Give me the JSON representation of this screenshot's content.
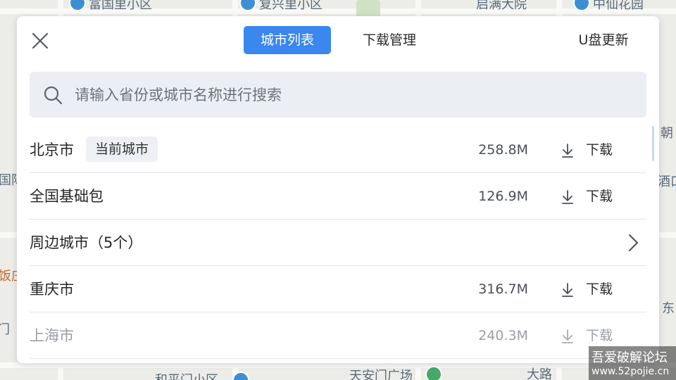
{
  "map": {
    "labels": [
      "富国里小区",
      "复兴里小区",
      "启满大院",
      "中仙花园",
      "朝",
      "国际",
      "酒口",
      "饭庄",
      "门",
      "东",
      "和平门小区",
      "天安门广场",
      "大路"
    ]
  },
  "dialog": {
    "tabs": [
      {
        "label": "城市列表",
        "active": true
      },
      {
        "label": "下载管理",
        "active": false
      },
      {
        "label": "U盘更新",
        "active": false
      }
    ],
    "search": {
      "placeholder": "请输入省份或城市名称进行搜索",
      "value": ""
    },
    "rows": [
      {
        "name": "北京市",
        "badge": "当前城市",
        "size": "258.8M",
        "action": "下载"
      },
      {
        "name": "全国基础包",
        "size": "126.9M",
        "action": "下载"
      },
      {
        "name": "周边城市（5个）"
      },
      {
        "name": "重庆市",
        "size": "316.7M",
        "action": "下载"
      },
      {
        "name": "上海市",
        "size": "240.3M",
        "action": "下载"
      }
    ]
  },
  "watermark": {
    "line1": "吾爱破解论坛",
    "line2": "www.52pojie.cn"
  },
  "colors": {
    "accent": "#3a87f0",
    "search_bg": "#ebeef3",
    "badge_bg": "#edf0f4"
  }
}
